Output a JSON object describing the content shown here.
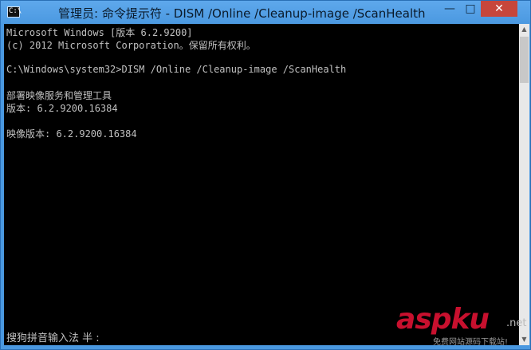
{
  "window": {
    "icon_label": "C:\\",
    "title": "管理员: 命令提示符 - DISM  /Online /Cleanup-image /ScanHealth",
    "minimize_label": "—",
    "maximize_label": "□",
    "close_label": "✕"
  },
  "console": {
    "lines": [
      "Microsoft Windows [版本 6.2.9200]",
      "(c) 2012 Microsoft Corporation。保留所有权利。",
      "",
      "C:\\Windows\\system32>DISM /Online /Cleanup-image /ScanHealth",
      "",
      "部署映像服务和管理工具",
      "版本: 6.2.9200.16384",
      "",
      "映像版本: 6.2.9200.16384"
    ],
    "ime_status": "搜狗拼音输入法 半 :"
  },
  "watermark": {
    "brand": "aspku",
    "suffix": ".net",
    "tagline": "免费网站源码下载站!"
  },
  "colors": {
    "console_bg": "#000000",
    "console_text": "#c0c0c0",
    "titlebar": "#4a98e0",
    "close_button": "#c7463b",
    "watermark": "#c8102e"
  }
}
